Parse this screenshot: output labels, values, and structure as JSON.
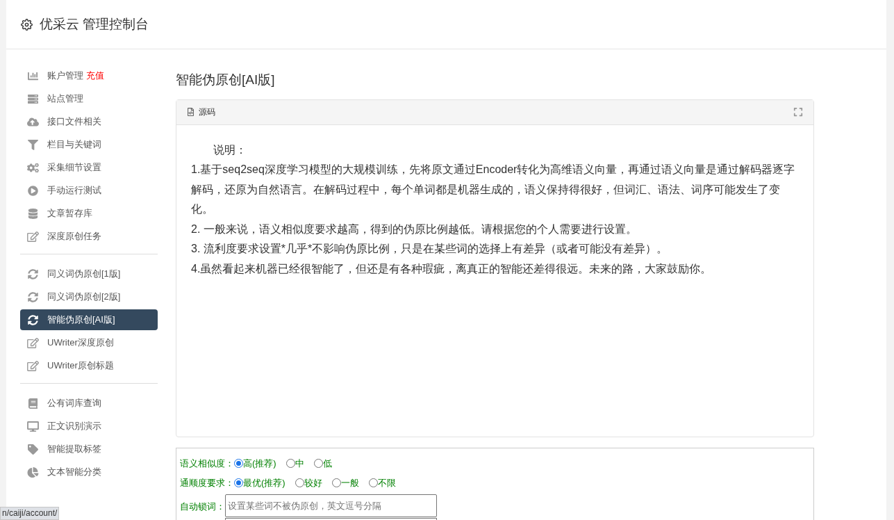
{
  "header": {
    "title": "优采云 管理控制台"
  },
  "sidebar": {
    "groups": [
      {
        "items": [
          {
            "kind": "chart",
            "label": "账户管理",
            "badge": "充值",
            "selected": false
          },
          {
            "kind": "server",
            "label": "站点管理",
            "selected": false
          },
          {
            "kind": "cloud",
            "label": "接口文件相关",
            "selected": false
          },
          {
            "kind": "filter",
            "label": "栏目与关键词",
            "selected": false
          },
          {
            "kind": "cogs",
            "label": "采集细节设置",
            "selected": false
          },
          {
            "kind": "play",
            "label": "手动运行测试",
            "selected": false
          },
          {
            "kind": "database",
            "label": "文章暂存库",
            "selected": false
          },
          {
            "kind": "edit",
            "label": "深度原创任务",
            "selected": false
          }
        ]
      },
      {
        "items": [
          {
            "kind": "refresh",
            "label": "同义词伪原创[1版]",
            "selected": false
          },
          {
            "kind": "refresh",
            "label": "同义词伪原创[2版]",
            "selected": false
          },
          {
            "kind": "refresh",
            "label": "智能伪原创[AI版]",
            "selected": true
          },
          {
            "kind": "edit",
            "label": "UWriter深度原创",
            "selected": false
          },
          {
            "kind": "edit",
            "label": "UWriter原创标题",
            "selected": false
          }
        ]
      },
      {
        "items": [
          {
            "kind": "book",
            "label": "公有词库查询",
            "selected": false
          },
          {
            "kind": "desktop",
            "label": "正文识别演示",
            "selected": false
          },
          {
            "kind": "tag",
            "label": "智能提取标签",
            "selected": false
          },
          {
            "kind": "pie",
            "label": "文本智能分类",
            "selected": false
          }
        ]
      }
    ]
  },
  "content": {
    "title": "智能伪原创[AI版]",
    "editor": {
      "tab": "源码",
      "lines": [
        "说明：",
        "1.基于seq2seq深度学习模型的大规模训练，先将原文通过Encoder转化为高维语义向量，再通过语义向量是通过解码器逐字解码，还原为自然语言。在解码过程中，每个单词都是机器生成的，语义保持得很好，但词汇、语法、词序可能发生了变化。",
        "2. 一般来说，语义相似度要求越高，得到的伪原比例越低。请根据您的个人需要进行设置。",
        "3. 流利度要求设置*几乎*不影响伪原比例，只是在某些词的选择上有差异（或者可能没有差异）。",
        "4.虽然看起来机器已经很智能了，但还是有各种瑕疵，离真正的智能还差得很远。未来的路，大家鼓励你。"
      ]
    },
    "form": {
      "radio_groups": [
        {
          "label": "语义相似度：",
          "options": [
            {
              "label": "高(推荐)",
              "selected": true
            },
            {
              "label": "中",
              "selected": false
            },
            {
              "label": "低",
              "selected": false
            }
          ]
        },
        {
          "label": "通顺度要求：",
          "options": [
            {
              "label": "最优(推荐)",
              "selected": true
            },
            {
              "label": "较好",
              "selected": false
            },
            {
              "label": "一般",
              "selected": false
            },
            {
              "label": "不限",
              "selected": false
            }
          ]
        }
      ],
      "lock_words": {
        "label": "自动锁词：",
        "placeholder": "设置某些词不被伪原创，英文逗号分隔"
      }
    }
  },
  "status_url": "n/caiji/account/"
}
